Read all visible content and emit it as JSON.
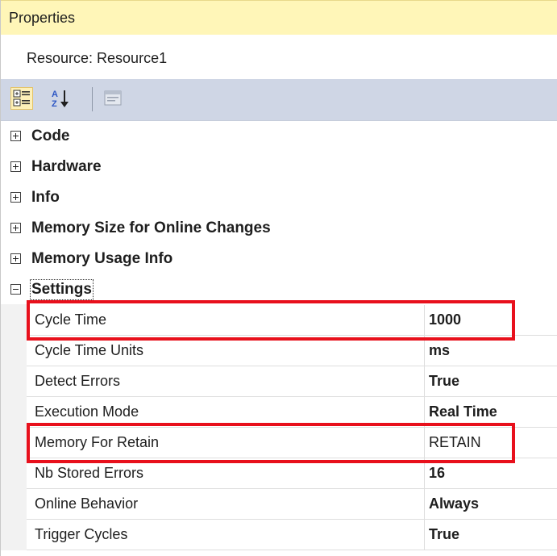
{
  "panel": {
    "title": "Properties",
    "resource_label": "Resource: Resource1"
  },
  "toolbar": {
    "buttons": [
      {
        "name": "categorized-icon",
        "active": true
      },
      {
        "name": "alphabetical-sort-icon",
        "active": false
      },
      {
        "name": "property-pages-icon",
        "active": false
      }
    ]
  },
  "categories": [
    {
      "label": "Code",
      "expanded": false
    },
    {
      "label": "Hardware",
      "expanded": false
    },
    {
      "label": "Info",
      "expanded": false
    },
    {
      "label": "Memory Size for Online Changes",
      "expanded": false
    },
    {
      "label": "Memory Usage Info",
      "expanded": false
    },
    {
      "label": "Settings",
      "expanded": true
    }
  ],
  "settings": [
    {
      "name": "Cycle Time",
      "value": "1000",
      "bold": true,
      "highlighted": true
    },
    {
      "name": "Cycle Time Units",
      "value": "ms",
      "bold": true,
      "highlighted": false
    },
    {
      "name": "Detect Errors",
      "value": "True",
      "bold": true,
      "highlighted": false
    },
    {
      "name": "Execution Mode",
      "value": "Real Time",
      "bold": true,
      "highlighted": false
    },
    {
      "name": "Memory For Retain",
      "value": "RETAIN",
      "bold": false,
      "highlighted": true
    },
    {
      "name": "Nb Stored Errors",
      "value": "16",
      "bold": true,
      "highlighted": false
    },
    {
      "name": "Online Behavior",
      "value": "Always",
      "bold": true,
      "highlighted": false
    },
    {
      "name": "Trigger Cycles",
      "value": "True",
      "bold": true,
      "highlighted": false
    }
  ],
  "colors": {
    "title_bar": "#fff6b8",
    "toolbar": "#cfd6e5",
    "highlight_border": "#e8101c"
  }
}
